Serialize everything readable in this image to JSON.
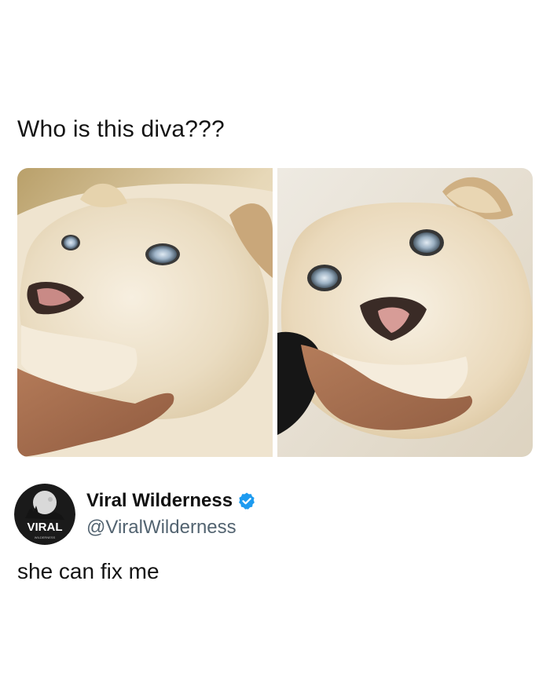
{
  "post": {
    "caption": "Who is this diva???",
    "text": "she can fix me"
  },
  "author": {
    "display_name": "Viral Wilderness",
    "handle": "@ViralWilderness",
    "verified": true,
    "avatar_text": "VIRAL",
    "avatar_subtext": "WILDERNESS"
  },
  "photos": [
    {
      "subject": "white lioness cub looking up, chin resting on a human hand"
    },
    {
      "subject": "white lioness cub looking up, chin held by a human hand"
    }
  ],
  "colors": {
    "verified_badge": "#1D9BF0",
    "handle": "#536471",
    "text": "#141414"
  }
}
